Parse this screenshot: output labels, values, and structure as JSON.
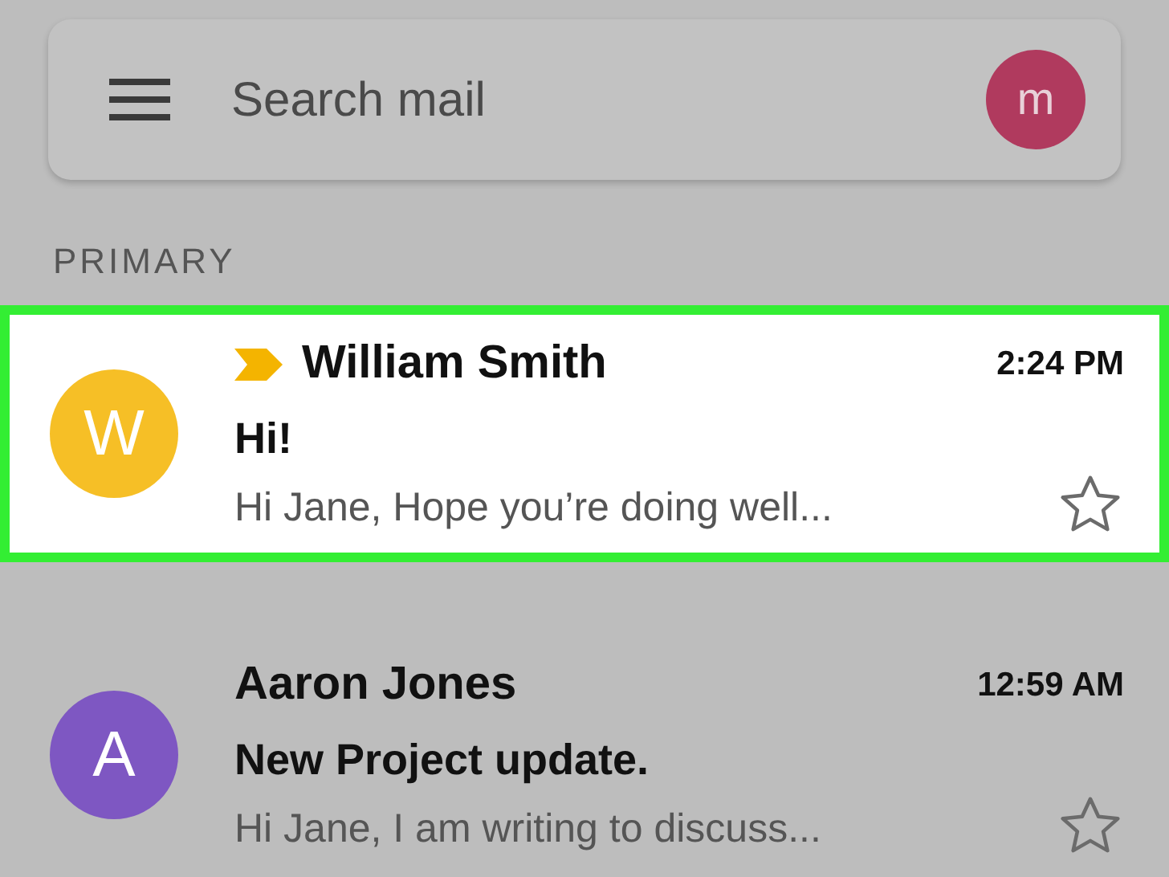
{
  "search": {
    "placeholder": "Search mail",
    "account_initial": "m"
  },
  "section": "PRIMARY",
  "emails": [
    {
      "initial": "W",
      "color": "#f6bf26",
      "important": true,
      "sender": "William Smith",
      "time": "2:24 PM",
      "subject": "Hi!",
      "snippet": "Hi Jane, Hope you’re doing well...",
      "starred": false,
      "selected": true
    },
    {
      "initial": "A",
      "color": "#7e57c2",
      "important": false,
      "sender": "Aaron Jones",
      "time": "12:59 AM",
      "subject": "New Project update.",
      "snippet": "Hi Jane, I am writing to discuss...",
      "starred": false,
      "selected": false
    }
  ]
}
